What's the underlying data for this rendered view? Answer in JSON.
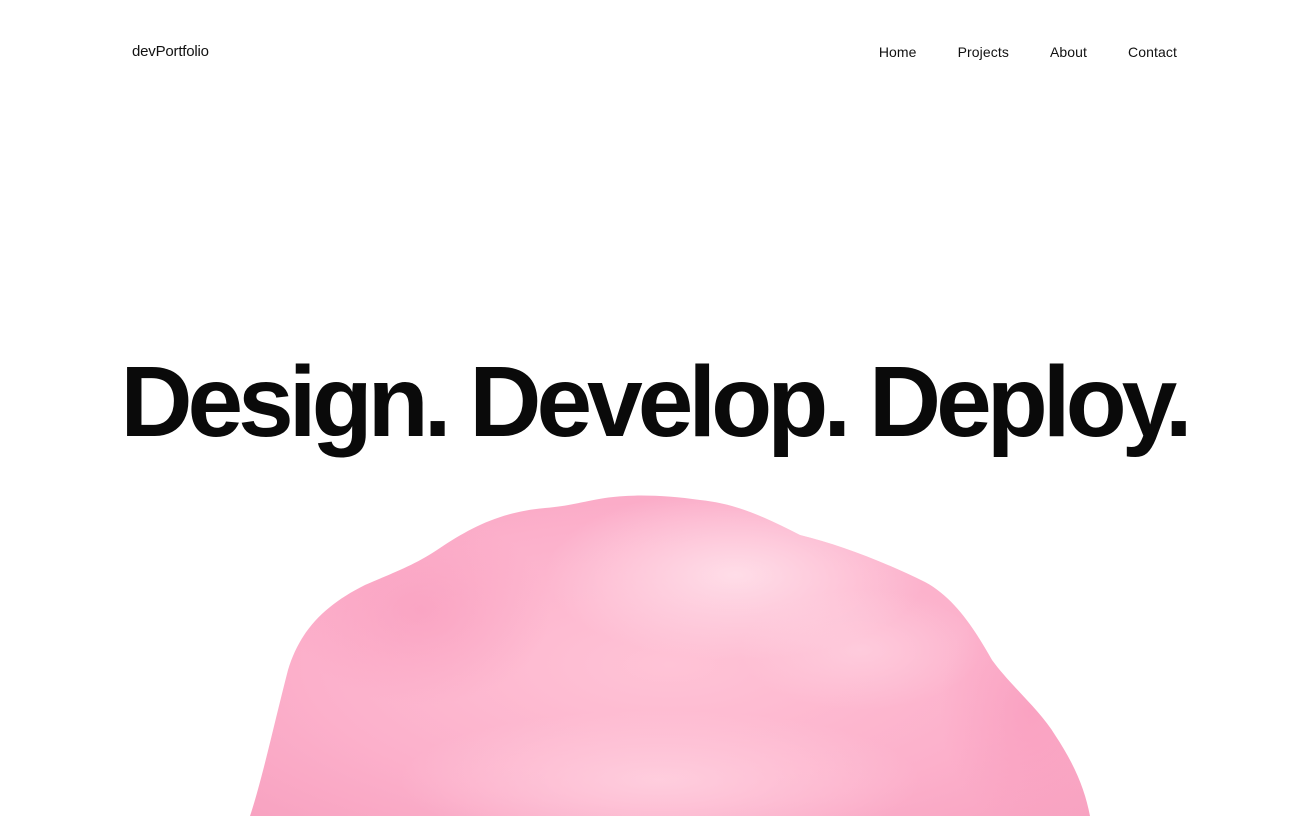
{
  "header": {
    "logo": "devPortfolio",
    "nav": {
      "home": "Home",
      "projects": "Projects",
      "about": "About",
      "contact": "Contact"
    }
  },
  "hero": {
    "title": "Design. Develop. Deploy."
  },
  "colors": {
    "background": "#ffffff",
    "text": "#0a0a0a",
    "blob_base": "#fbaeca",
    "blob_highlight": "#ffd7e3"
  },
  "decoration": {
    "blob": "pink-3d-blob"
  }
}
